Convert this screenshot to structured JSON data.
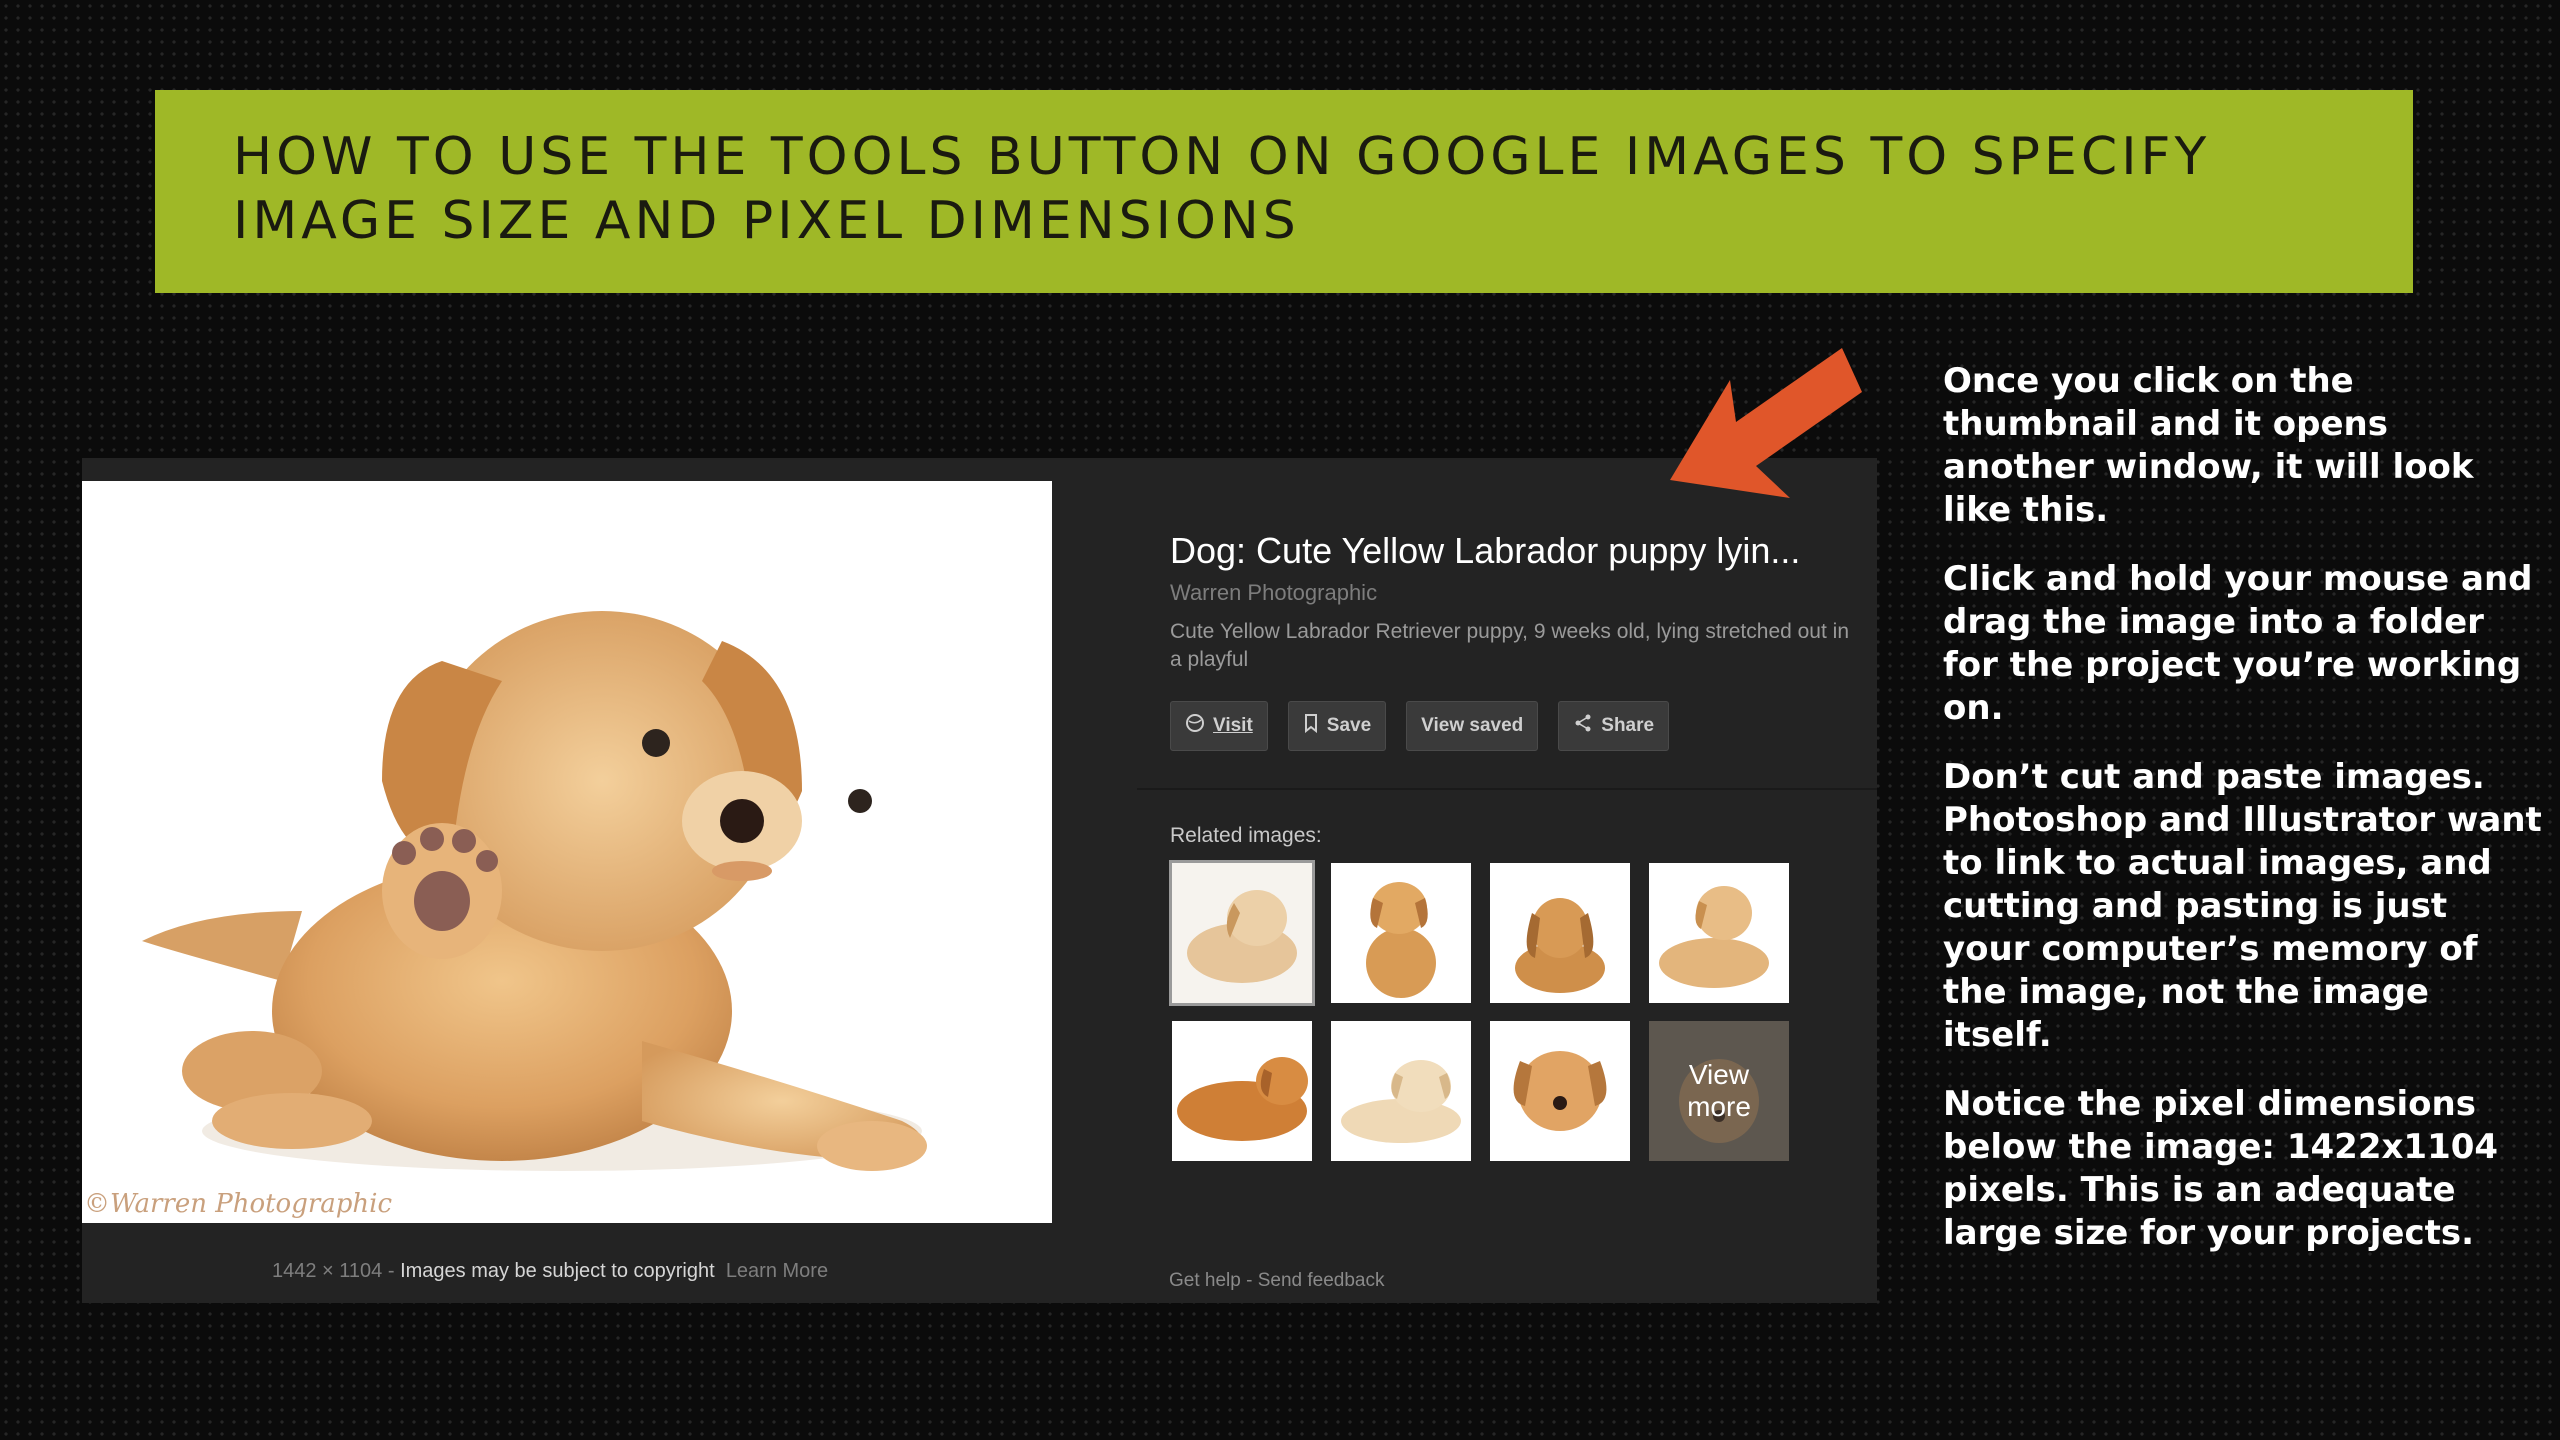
{
  "title": {
    "line1": "HOW TO USE THE TOOLS BUTTON ON GOOGLE IMAGES TO SPECIFY",
    "line2": "IMAGE SIZE AND PIXEL DIMENSIONS"
  },
  "image_viewer": {
    "watermark": "©Warren Photographic",
    "dimensions": "1442 × 1104",
    "separator": " - ",
    "copyright_notice": "Images may be subject to copyright",
    "learn_more_link": "Learn More"
  },
  "result": {
    "title": "Dog: Cute Yellow Labrador puppy lyin...",
    "source": "Warren Photographic",
    "description": "Cute Yellow Labrador Retriever puppy, 9 weeks old, lying stretched out in a playful"
  },
  "actions": {
    "visit": "Visit",
    "save": "Save",
    "view_saved": "View saved",
    "share": "Share"
  },
  "related": {
    "label": "Related images:",
    "view_more_line1": "View",
    "view_more_line2": "more"
  },
  "footer": {
    "get_help": "Get help",
    "separator": " - ",
    "send_feedback": "Send feedback"
  },
  "instructions": [
    "Once you click on the thumbnail and it opens another window, it will look like this.",
    "Click and hold your mouse and drag the image into a folder for the project you’re working on.",
    "Don’t cut and paste images. Photoshop and Illustrator want to link to actual images, and cutting and pasting is just your computer’s memory of the image, not the image itself.",
    "Notice the pixel dimensions below the image: 1422x1104 pixels. This is an adequate large size for your projects."
  ],
  "colors": {
    "banner": "#9fb827",
    "arrow": "#e0562a",
    "panel": "#232323"
  }
}
